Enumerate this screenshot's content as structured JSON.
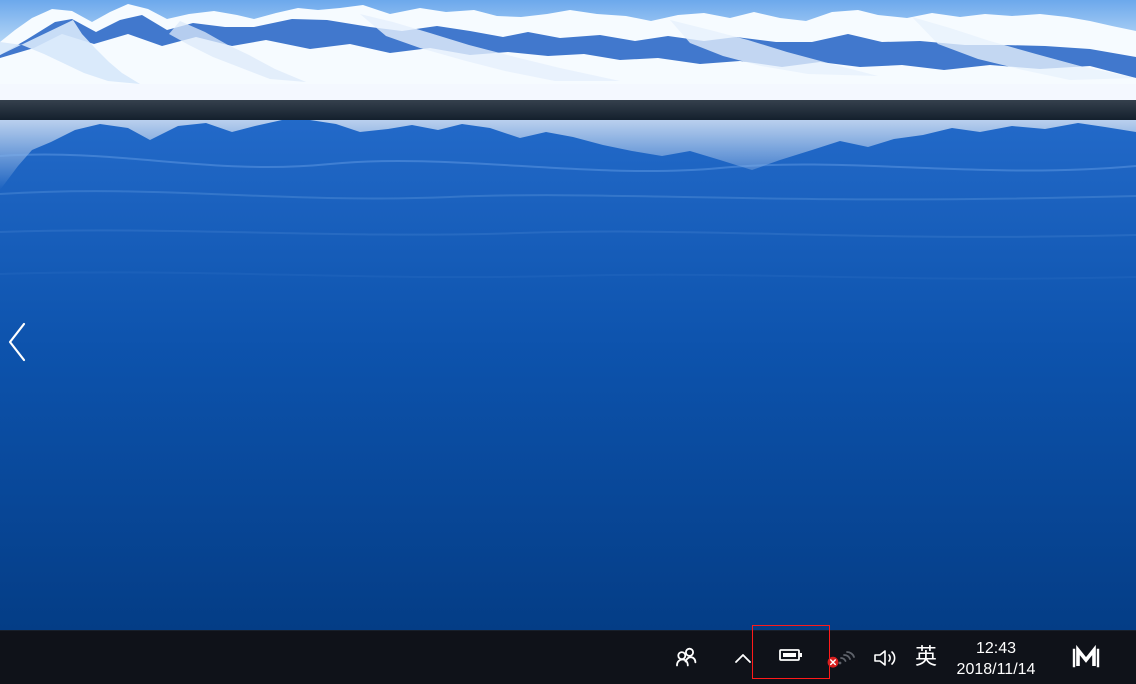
{
  "screen": {
    "colors": {
      "sky": "#dceefa",
      "snow": "#f8fbff",
      "mountain_shadow": "#2b69c9",
      "lake_top": "#2a74d6",
      "lake_mid": "#0d53ad",
      "lake_bottom": "#043d86",
      "taskbar": "#0f1219",
      "selection_outline": "#ff1a1a",
      "network_error": "#d81f1f"
    }
  },
  "wallpaper": {
    "navigation_icon": "chevron-left-icon"
  },
  "taskbar": {
    "system_tray": {
      "people_icon": "people-icon",
      "overflow_icon": "chevron-up-icon",
      "battery_icon": "battery-icon",
      "network_icon": "wifi-disconnected-icon",
      "volume_icon": "volume-icon",
      "input_method": "英",
      "clock": {
        "time": "12:43",
        "date": "2018/11/14"
      },
      "action_center_icon": "action-center-icon"
    }
  }
}
